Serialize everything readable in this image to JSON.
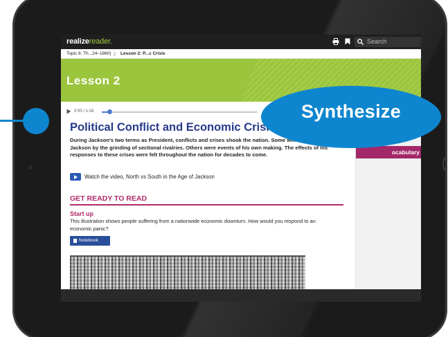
{
  "app": {
    "brand_strong": "realize",
    "brand_light": "reader.",
    "search_placeholder": "Search"
  },
  "breadcrumb": {
    "topic": "Topic 6: Th...24–1860)",
    "separator": "〉",
    "lesson": "Lesson 2: P...c Crisis"
  },
  "banner": {
    "title": "Lesson 2",
    "color": "#9bc53d"
  },
  "player": {
    "time": "0:00 / 1:16",
    "progress_fraction": 0.05
  },
  "content": {
    "heading": "Political Conflict and Economic Crisis",
    "intro": "During Jackson's two terms as President, conflicts and crises shook the nation. Some were thrust upon Jackson by the grinding of sectional rivalries. Others were events of his own making. The effects of his responses to these crises were felt throughout the nation for decades to come.",
    "video_link": "Watch the video, North vs South in the Age of Jackson",
    "section_heading": "GET READY TO READ",
    "startup_heading": "Start up",
    "startup_text": "This illustration shows people suffering from a nationwide economic downturn. How would you respond to an economic panic?",
    "notebook_label": "Notebook"
  },
  "sidebar": {
    "vocab_tab": "ocabulary"
  },
  "callout": {
    "label": "Synthesize",
    "color": "#0e86cf"
  },
  "icons": [
    "print-icon",
    "bookmark-icon",
    "search-icon",
    "play-icon",
    "volume-icon",
    "video-play-icon",
    "notebook-icon"
  ]
}
